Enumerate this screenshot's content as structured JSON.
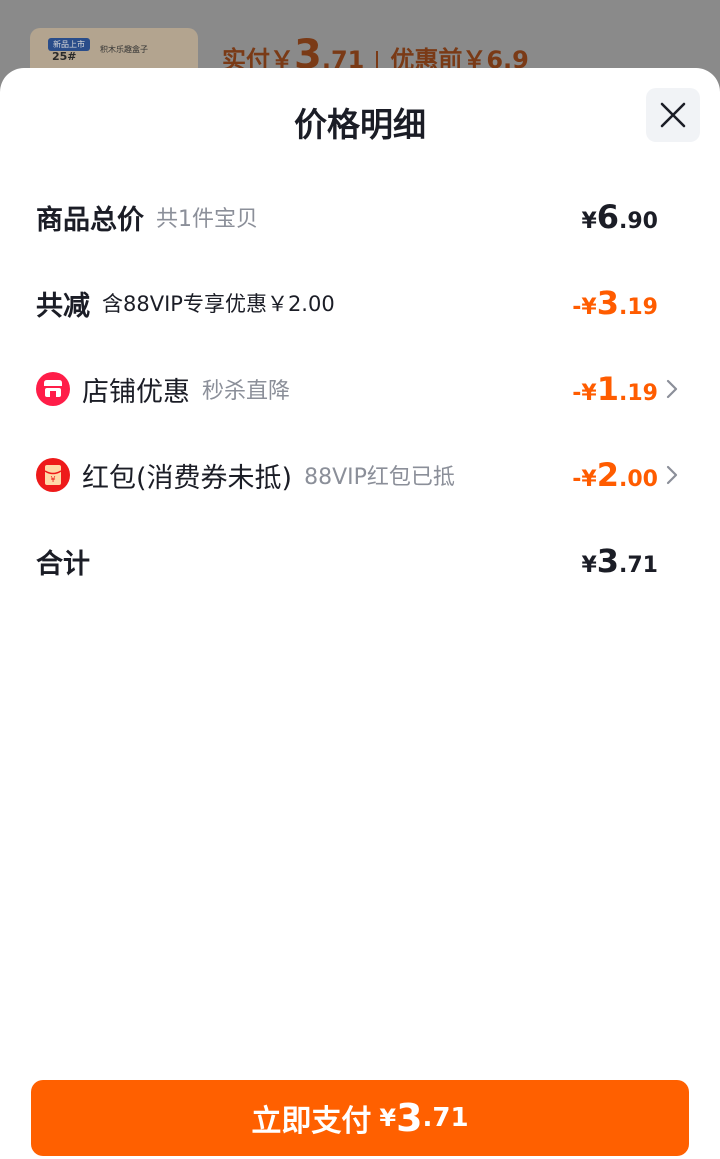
{
  "background": {
    "product_tag": "新品上市",
    "product_number": "25#",
    "product_brand": "积木乐趣盒子",
    "actual_label": "实付￥",
    "actual_int": "3",
    "actual_dec": ".71",
    "before_label": "优惠前￥6.9"
  },
  "sheet": {
    "title": "价格明细",
    "close_icon": "close-icon"
  },
  "rows": {
    "total": {
      "label": "商品总价",
      "sub": "共1件宝贝",
      "currency": "¥",
      "int": "6",
      "dec": ".90"
    },
    "discount": {
      "label": "共减",
      "sub": "含88VIP专享优惠￥2.00",
      "currency": "-¥",
      "int": "3",
      "dec": ".19"
    },
    "shop": {
      "label": "店铺优惠",
      "sub": "秒杀直降",
      "currency": "-¥",
      "int": "1",
      "dec": ".19",
      "icon": "shop-icon"
    },
    "redpacket": {
      "label": "红包(消费券未抵)",
      "sub": "88VIP红包已抵",
      "currency": "-¥",
      "int": "2",
      "dec": ".00",
      "icon": "red-packet-icon"
    },
    "sum": {
      "label": "合计",
      "currency": "¥",
      "int": "3",
      "dec": ".71"
    }
  },
  "pay_button": {
    "label": "立即支付",
    "currency": "¥",
    "int": "3",
    "dec": ".71"
  },
  "colors": {
    "accent": "#ff6000",
    "discount": "#ff5c00",
    "shop_icon": "#ff1d48"
  }
}
